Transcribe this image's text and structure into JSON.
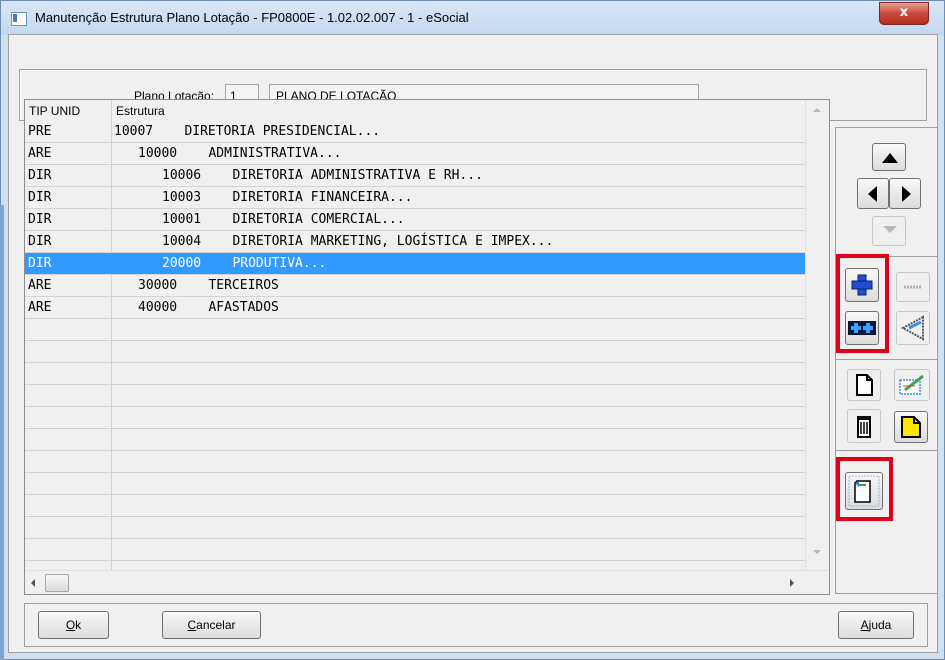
{
  "window": {
    "title": "Manutenção Estrutura Plano Lotação - FP0800E - 1.02.02.007 - 1 - eSocial",
    "close_label": "x"
  },
  "header": {
    "plano_label": "Plano Lotação:",
    "plano_number": "1",
    "plano_description": "PLANO DE LOTAÇÃO"
  },
  "grid": {
    "columns": [
      "TIP UNID",
      "Estrutura"
    ],
    "rows": [
      {
        "tip": "PRE",
        "estrutura": "10007    DIRETORIA PRESIDENCIAL...",
        "level": 0,
        "selected": false
      },
      {
        "tip": "ARE",
        "estrutura": "10000    ADMINISTRATIVA...",
        "level": 1,
        "selected": false
      },
      {
        "tip": "DIR",
        "estrutura": "10006    DIRETORIA ADMINISTRATIVA E RH...",
        "level": 2,
        "selected": false
      },
      {
        "tip": "DIR",
        "estrutura": "10003    DIRETORIA FINANCEIRA...",
        "level": 2,
        "selected": false
      },
      {
        "tip": "DIR",
        "estrutura": "10001    DIRETORIA COMERCIAL...",
        "level": 2,
        "selected": false
      },
      {
        "tip": "DIR",
        "estrutura": "10004    DIRETORIA MARKETING, LOGÍSTICA E IMPEX...",
        "level": 2,
        "selected": false
      },
      {
        "tip": "DIR",
        "estrutura": "20000    PRODUTIVA...",
        "level": 2,
        "selected": true
      },
      {
        "tip": "ARE",
        "estrutura": "30000    TERCEIROS",
        "level": 1,
        "selected": false
      },
      {
        "tip": "ARE",
        "estrutura": "40000    AFASTADOS",
        "level": 1,
        "selected": false
      },
      {
        "tip": "",
        "estrutura": "",
        "level": 0,
        "selected": false
      },
      {
        "tip": "",
        "estrutura": "",
        "level": 0,
        "selected": false
      },
      {
        "tip": "",
        "estrutura": "",
        "level": 0,
        "selected": false
      },
      {
        "tip": "",
        "estrutura": "",
        "level": 0,
        "selected": false
      },
      {
        "tip": "",
        "estrutura": "",
        "level": 0,
        "selected": false
      },
      {
        "tip": "",
        "estrutura": "",
        "level": 0,
        "selected": false
      },
      {
        "tip": "",
        "estrutura": "",
        "level": 0,
        "selected": false
      },
      {
        "tip": "",
        "estrutura": "",
        "level": 0,
        "selected": false
      },
      {
        "tip": "",
        "estrutura": "",
        "level": 0,
        "selected": false
      },
      {
        "tip": "",
        "estrutura": "",
        "level": 0,
        "selected": false
      },
      {
        "tip": "",
        "estrutura": "",
        "level": 0,
        "selected": false
      },
      {
        "tip": "",
        "estrutura": "",
        "level": 0,
        "selected": false
      },
      {
        "tip": "",
        "estrutura": "",
        "level": 0,
        "selected": false
      }
    ]
  },
  "side_icons": {
    "move_up": "arrow-up-icon",
    "move_left": "arrow-left-icon",
    "move_right": "arrow-right-icon",
    "move_down": "arrow-down-icon",
    "add": "plus-icon",
    "add_multiple": "double-plus-icon",
    "disabled": "dotted-line-icon",
    "triangle": "pencil-triangle-icon",
    "new": "new-document-icon",
    "edit": "edit-document-icon",
    "delete": "trash-icon",
    "note": "yellow-note-icon",
    "document": "document-icon"
  },
  "footer": {
    "ok_first": "O",
    "ok_rest": "k",
    "cancel_first": "C",
    "cancel_rest": "ancelar",
    "help_first": "A",
    "help_rest": "juda"
  },
  "colors": {
    "selection": "#3399ff",
    "highlight": "#e0001b",
    "title_bar": "#c2d7ef",
    "close_button": "#c9483a"
  }
}
